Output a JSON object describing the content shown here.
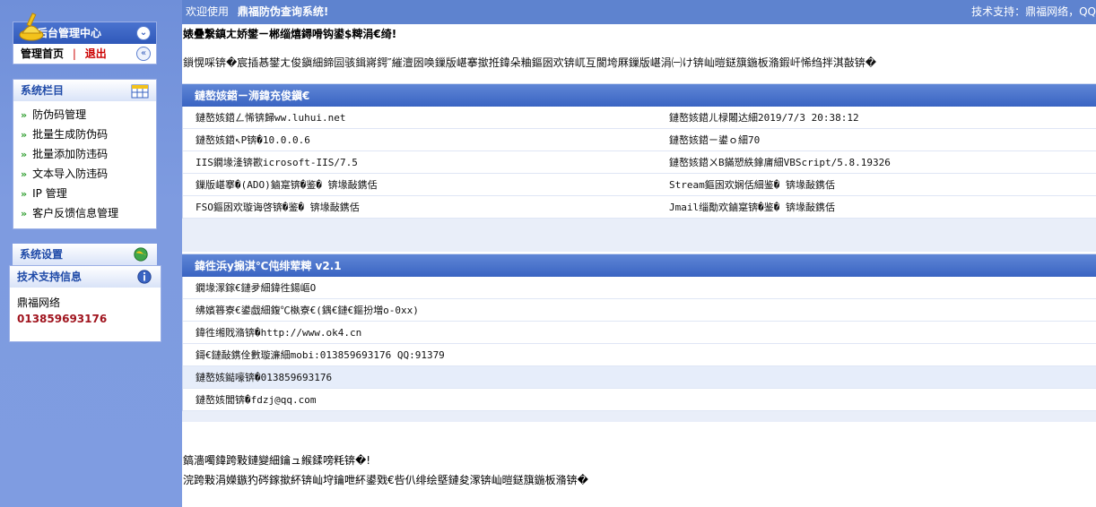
{
  "topbar": {
    "welcome_prefix": "欢迎使用",
    "system_name": "鼎福防伪查询系统!",
    "tech_support": "技术支持：鼎福网络，QQ"
  },
  "sidebar": {
    "admin_panel": {
      "title": "后台管理中心",
      "home_label": "管理首页",
      "separator": "|",
      "logout_label": "退出",
      "collapse_symbol": "«"
    },
    "columns": {
      "title": "系统栏目",
      "items": [
        {
          "label": "防伪码管理"
        },
        {
          "label": "批量生成防伪码"
        },
        {
          "label": "批量添加防违码"
        },
        {
          "label": "文本导入防违码"
        },
        {
          "label": "IP 管理"
        },
        {
          "label": "客户反馈信息管理"
        }
      ]
    },
    "settings": {
      "title": "系统设置"
    },
    "support": {
      "title": "技术支持信息",
      "company": "鼎福网络",
      "phone": "013859693176"
    }
  },
  "main": {
    "notice_title": "婊曡繋鎮ㄤ娇鐢ㄧ郴缁熺鐞嗗钩鍙$粺涓€绮!",
    "notice_text": "鎻愰啋锛�宸插惎鐢ㄤ俊鎭細鍗囩骇鍓嶈鍔″繀澶囦唤鏁版嵁搴撳拰鍏朵粬鏂囦欢锛屼互閬垮厤鏁版嵁涓㈠け锛屾暟鎹簱鍦板潃鍜屽悕绉拌淇敼锛�",
    "server_section": {
      "title": "鏈嶅姟鍣ㄧ浉鍏充俊鎭€",
      "rows": [
        {
          "left": "鏈嶅姟鍣ㄥ悕锛歸ww.luhui.net",
          "right": "鏈嶅姟鍣ㄦ椂闂达細2019/7/3 20:38:12"
        },
        {
          "left": "鏈嶅姟鍣↖P锛�10.0.0.6",
          "right": "鏈嶅姟鍣ㄧ鍙ｏ細70"
        },
        {
          "left": "IIS鐗堟湰锛歁icrosoft-IIS/7.5",
          "right": "鏈嶅姟鍣ㄨВ鏋愬紩鎿庯細VBScript/5.8.19326"
        },
        {
          "left": "鏁版嵁搴�(ADO)鏀寔锛�鉴�  锛堟敮鎸佸",
          "right": "Stream鏂囦欢娴佸細鉴�  锛堟敮鎸佸"
        },
        {
          "left": "FSO鏂囦欢璇诲啓锛�鉴�  锛堟敮鎸佸",
          "right": "Jmail缁勪欢鏀寔锛�鉴�  锛堟敮鎸佸"
        }
      ]
    },
    "product_section": {
      "title": "鍏徃浜у搧淇℃伅绯荤粺  v2.1",
      "rows": [
        {
          "left": "鐗堟潈鎵€鏈夛細鍏徃鍚嶇О",
          "hl": false
        },
        {
          "left": "绋嬪簭寮€鍙戯細鍑℃槸寮€(鍝€鏈€鏂扮増o-0xx)",
          "hl": false
        },
        {
          "left": "鍏徃缃戝潃锛�http://www.ok4.cn",
          "hl": false
        },
        {
          "left": "鎶€鏈敮鎸佺數璇濓細mobi:013859693176 QQ:91379",
          "hl": false
        },
        {
          "left": "鏈嶅姟鐑嚎锛�013859693176",
          "hl": true
        },
        {
          "left": "鏈嶅姟閭锛�fdzj@qq.com",
          "hl": false
        }
      ]
    },
    "footer_line1": "鎬濇噣鍏跨敤鏈變細鑰ュ緱鍒嗙粍锛�!",
    "footer_line2": "浣跨敤涓嬫鏃犳硶鎵撳紑锛屾垨鑰呭紑鍙戣€呰仈绯绘墍鏈夋潈锛屾暟鎹簱鍦板潃锛�"
  },
  "colors": {
    "sidebar_bg": "#7f9ce1",
    "topbar_bg": "#5e83cf",
    "section_header": "#3a64c2",
    "logout_red": "#cc0000",
    "phone_red": "#a0141e"
  }
}
